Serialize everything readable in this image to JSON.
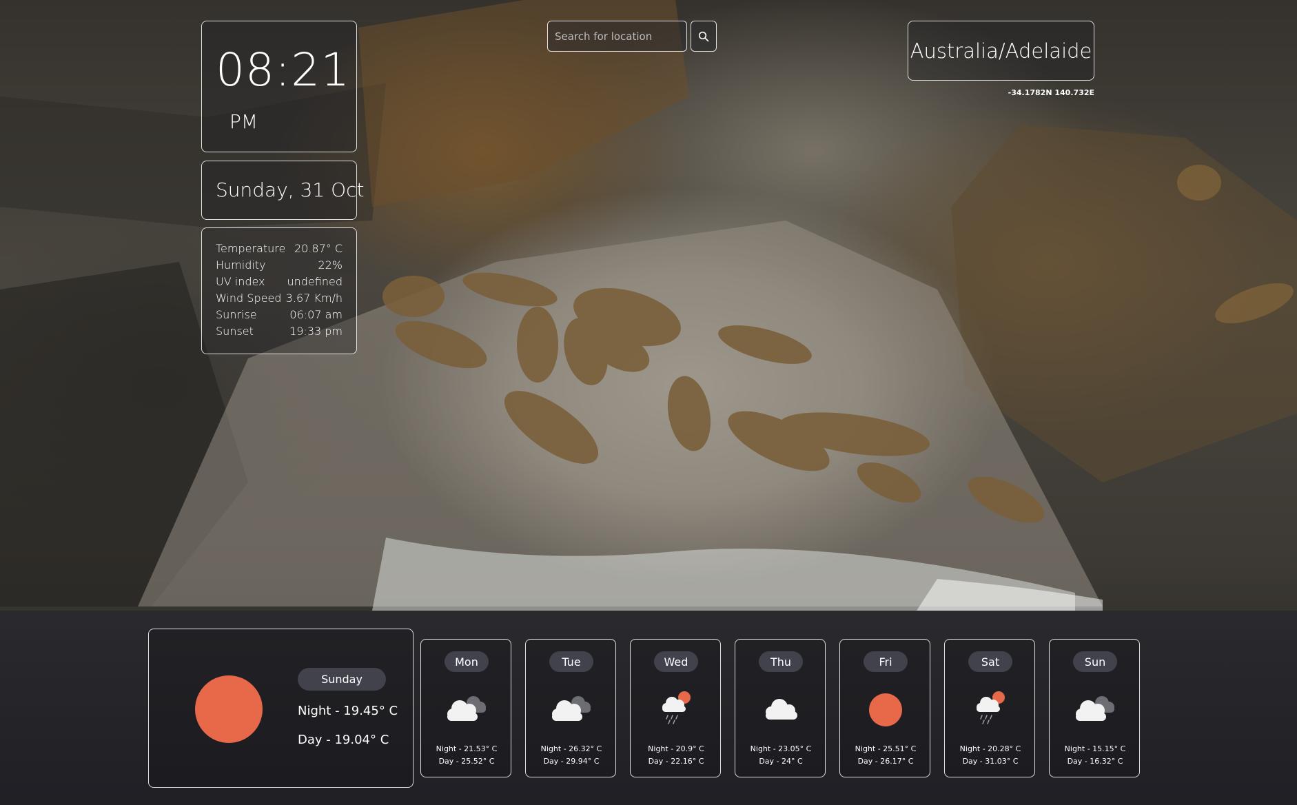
{
  "clock": {
    "time": "08:21",
    "ampm": "PM"
  },
  "date": {
    "text": "Sunday, 31 Oct"
  },
  "stats": [
    {
      "label": "Temperature",
      "value": "20.87° C"
    },
    {
      "label": "Humidity",
      "value": "22%"
    },
    {
      "label": "UV index",
      "value": "undefined"
    },
    {
      "label": "Wind Speed",
      "value": "3.67 Km/h"
    },
    {
      "label": "Sunrise",
      "value": "06:07 am"
    },
    {
      "label": "Sunset",
      "value": "19:33 pm"
    }
  ],
  "search": {
    "placeholder": "Search for location",
    "value": ""
  },
  "location": {
    "timezone": "Australia/Adelaide",
    "coordinates": "-34.1782N 140.732E"
  },
  "today": {
    "day": "Sunday",
    "night": "Night - 19.45° C",
    "day_temp": "Day - 19.04° C",
    "icon": "sun-icon"
  },
  "forecast": [
    {
      "day": "Mon",
      "icon": "clouds-icon",
      "night": "Night - 21.53° C",
      "day_temp": "Day - 25.52° C"
    },
    {
      "day": "Tue",
      "icon": "clouds-icon",
      "night": "Night - 26.32° C",
      "day_temp": "Day - 29.94° C"
    },
    {
      "day": "Wed",
      "icon": "rain-sun-icon",
      "night": "Night - 20.9° C",
      "day_temp": "Day - 22.16° C"
    },
    {
      "day": "Thu",
      "icon": "cloud-icon",
      "night": "Night - 23.05° C",
      "day_temp": "Day - 24° C"
    },
    {
      "day": "Fri",
      "icon": "sun-icon",
      "night": "Night - 25.51° C",
      "day_temp": "Day - 26.17° C"
    },
    {
      "day": "Sat",
      "icon": "rain-sun-icon",
      "night": "Night - 20.28° C",
      "day_temp": "Day - 31.03° C"
    },
    {
      "day": "Sun",
      "icon": "clouds-icon",
      "night": "Night - 15.15° C",
      "day_temp": "Day - 16.32° C"
    }
  ],
  "colors": {
    "sun": "#e8694a",
    "pill": "#41424c",
    "card_border": "#ffffff"
  }
}
